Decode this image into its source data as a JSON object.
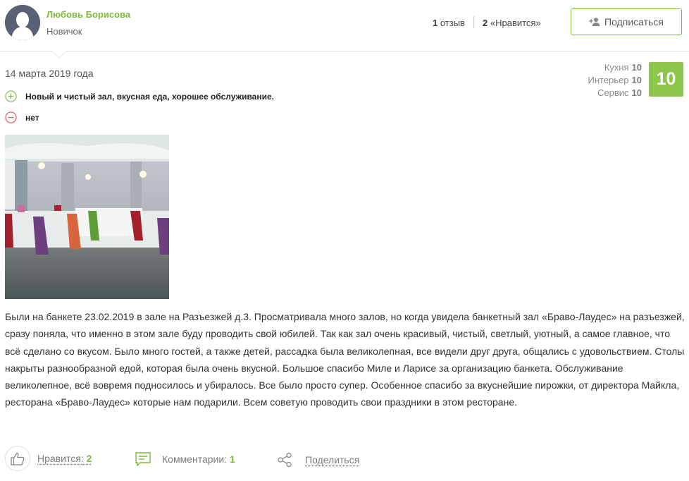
{
  "author": {
    "name": "Любовь Борисова",
    "rank": "Новичок",
    "reviews_count": "1",
    "reviews_label": "отзыв",
    "likes_count": "2",
    "likes_label": "«Нравится»"
  },
  "subscribe": {
    "label": "Подписаться",
    "icon": "add-user-icon"
  },
  "review": {
    "date": "14 марта 2019 года",
    "pro": "Новый и чистый зал, вкусная еда, хорошее обслуживание.",
    "con": "нет",
    "ratings": [
      {
        "label": "Кухня",
        "value": "10"
      },
      {
        "label": "Интерьер",
        "value": "10"
      },
      {
        "label": "Сервис",
        "value": "10"
      }
    ],
    "score": "10",
    "text": "Были на банкете 23.02.2019 в зале на Разъезжей д.3. Просматривала много залов, но когда увидела банкетный зал «Браво-Лаудес» на разъезжей, сразу поняла, что именно в этом зале буду проводить свой юбилей. Так как зал очень красивый, чистый, светлый, уютный, а самое главное, что всё сделано со вкусом. Было много гостей, а также детей, рассадка была великолепная, все видели друг друга, общались с удовольствием. Столы накрыты разнообразной едой, которая была очень вкусной. Большое спасибо Миле и Ларисе за организацию банкета. Обслуживание великолепное, всё вовремя подносилось и убиралось. Все было просто супер. Особенное спасибо за вкуснейшие пирожки, от директора Майкла, ресторана «Браво-Лаудес» которые нам подарили. Всем советую проводить свои праздники в этом ресторане."
  },
  "actions": {
    "like_label": "Нравится:",
    "like_count": "2",
    "comments_label": "Комментарии:",
    "comments_count": "1",
    "share_label": "Поделиться"
  },
  "colors": {
    "accent": "#7dba3a",
    "score_bg": "#8dc64a",
    "con": "#e0534c"
  }
}
